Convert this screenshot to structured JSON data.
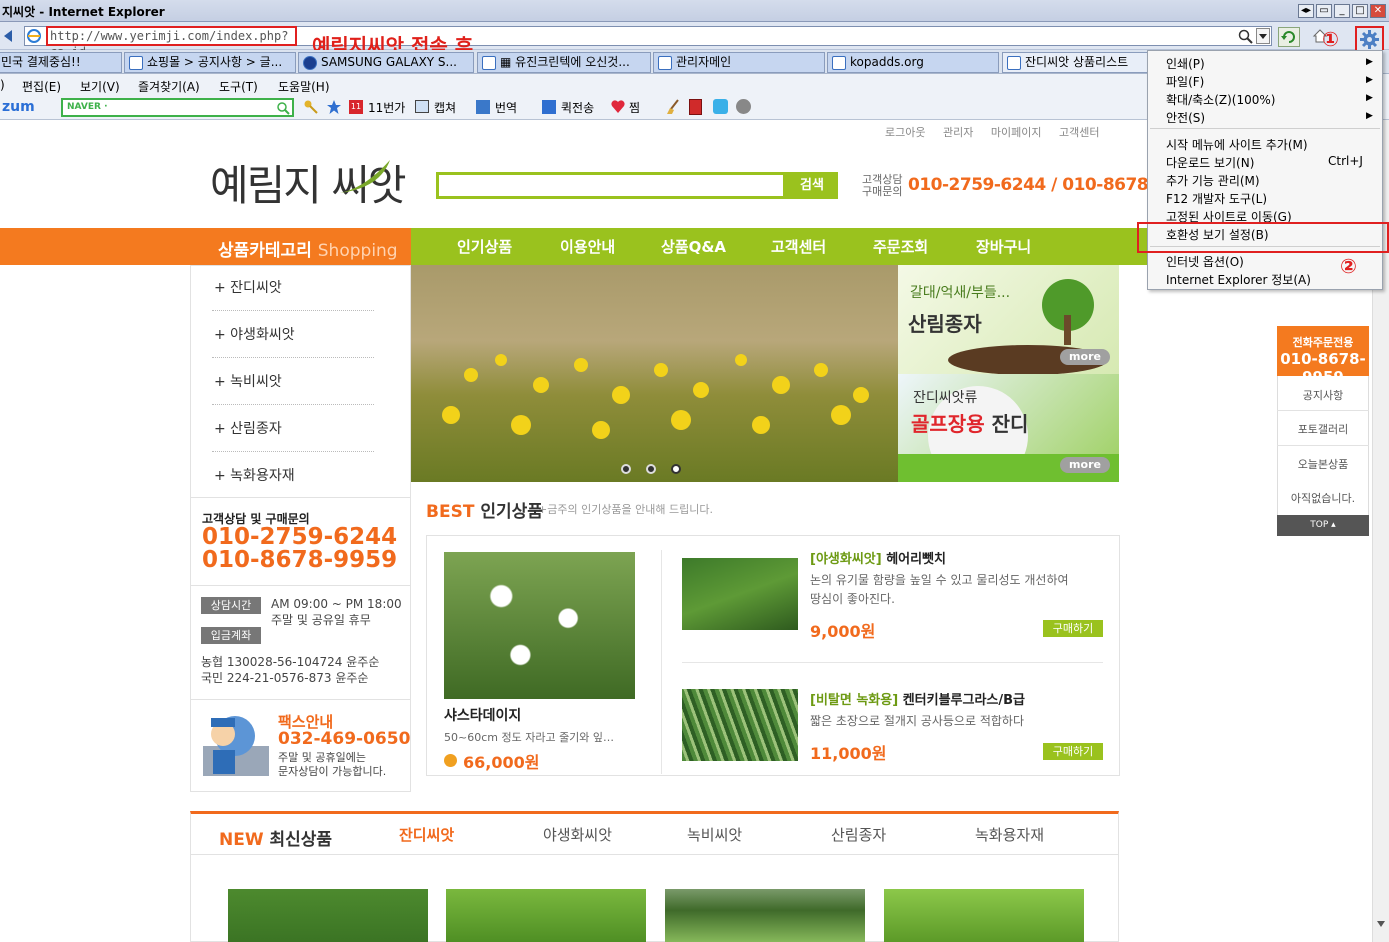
{
  "window": {
    "title": "지씨앗 - Internet Explorer",
    "buttons": [
      "◂▸",
      "▭",
      "_",
      "□",
      "✕"
    ]
  },
  "address": {
    "url": "http://www.yerimji.com/index.php?ca_id=",
    "annotation": "예림지씨앗 접속 후",
    "search_icon": "magnifier-icon",
    "refresh_icon": "refresh-icon"
  },
  "tabs": [
    "민국 결제중심!!",
    "쇼핑몰 > 공지사항 > 글...",
    "SAMSUNG GALAXY S...",
    "▦ 유진크린텍에 오신것...",
    "관리자메인",
    "kopadds.org",
    "잔디씨앗 상품리스트"
  ],
  "menu": [
    ")",
    "편집(E)",
    "보기(V)",
    "즐겨찾기(A)",
    "도구(T)",
    "도움말(H)"
  ],
  "toolbar": {
    "zum": "zum",
    "naver_placeholder": "NAVER ·",
    "items": [
      "11번가",
      "캡쳐",
      "번역",
      "퀵전송",
      "찜"
    ]
  },
  "page": {
    "top_links": [
      "로그아웃",
      "관리자",
      "마이페이지",
      "고객센터"
    ],
    "logo": "예림지 씨앗",
    "search_button": "검색",
    "cs_label_1": "고객상담",
    "cs_label_2": "구매문의",
    "cs_phone": "010-2759-6244 / 010-8678-9959",
    "category_title": "상품카테고리",
    "category_title_en": "Shopping",
    "nav": [
      "인기상품",
      "이용안내",
      "상품Q&A",
      "고객센터",
      "주문조회",
      "장바구니"
    ],
    "categories": [
      "+ 잔디씨앗",
      "+ 야생화씨앗",
      "+ 녹비씨앗",
      "+ 산림종자",
      "+ 녹화용자재"
    ],
    "contact_title": "고객상담 및 구매문의",
    "contact_phone1": "010-2759-6244",
    "contact_phone2": "010-8678-9959",
    "hours_label": "상담시간",
    "hours_1": "AM 09:00 ~ PM 18:00",
    "hours_2": "주말 및 공유일 휴무",
    "bank_label": "입금계좌",
    "bank_1": "농협 130028-56-104724 윤주순",
    "bank_2": "국민 224-21-0576-873 윤주순",
    "fax_title": "팩스안내",
    "fax_num": "032-469-0650",
    "fax_note_1": "주말 및 공휴일에는",
    "fax_note_2": "문자상담이 가능합니다.",
    "promo1_small": "갈대/억새/부들...",
    "promo1_big": "산림종자",
    "promo2_small": "잔디씨앗류",
    "promo2_big_1": "골프장용",
    "promo2_big_2": " 잔디",
    "more": "more",
    "best_title_1": "BEST",
    "best_title_2": " 인기상품",
    "best_sub": "+금주의 인기상품을 안내해 드립니다.",
    "best_name": "샤스타데이지",
    "best_desc": "50~60cm 정도 자라고 줄기와 잎…",
    "best_price": "66,000원",
    "products": [
      {
        "cat": "[야생화씨앗]",
        "name": " 헤어리뻿치",
        "desc_1": "논의 유기물 함량을 높일 수 있고 물리성도 개선하여",
        "desc_2": "땅심이 좋아진다.",
        "price": "9,000원",
        "buy": "구매하기"
      },
      {
        "cat": "[비탈면 녹화용]",
        "name": " 켄터키블루그라스/B급",
        "desc_1": "짧은 초장으로 절개지 공사등으로 적합하다",
        "desc_2": "",
        "price": "11,000원",
        "buy": "구매하기"
      }
    ],
    "new_title_1": "NEW",
    "new_title_2": " 최신상품",
    "new_tabs": [
      "잔디씨앗",
      "야생화씨앗",
      "녹비씨앗",
      "산림종자",
      "녹화용자재"
    ],
    "quick": {
      "head_1": "전화주문전용",
      "head_2": "010-8678-9959",
      "items": [
        "공지사항",
        "포토갤러리",
        "오늘본상품",
        "아직없습니다."
      ],
      "top": "TOP ▴"
    }
  },
  "context_menu": {
    "items": [
      "인쇄(P)",
      "파일(F)",
      "확대/축소(Z)(100%)",
      "안전(S)",
      "시작 메뉴에 사이트 추가(M)",
      "다운로드 보기(N)",
      "추가 기능 관리(M)",
      "F12 개발자 도구(L)",
      "고정된 사이트로 이동(G)",
      "호환성 보기 설정(B)",
      "인터넷 옵션(O)",
      "Internet Explorer 정보(A)"
    ],
    "shortcut": "Ctrl+J",
    "step1": "①",
    "step2": "②"
  }
}
